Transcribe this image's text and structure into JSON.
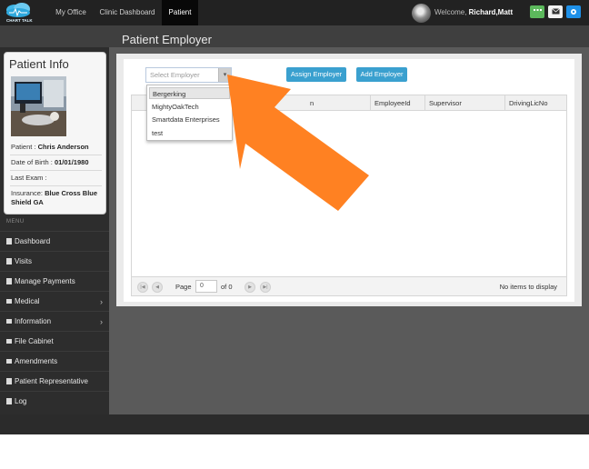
{
  "app": {
    "logo_text": "CHART TALK"
  },
  "nav": {
    "items": [
      {
        "label": "My Office"
      },
      {
        "label": "Clinic Dashboard"
      },
      {
        "label": "Patient"
      }
    ],
    "welcome_prefix": "Welcome,",
    "welcome_user": "Richard,Matt",
    "icons": [
      "grid-icon",
      "mail-icon",
      "gear-icon"
    ],
    "button_colors": [
      "#5cb85c",
      "#f2f2f2",
      "#1e90e8"
    ]
  },
  "page": {
    "title": "Patient Employer"
  },
  "patient_info": {
    "title": "Patient Info",
    "patient_label": "Patient :",
    "patient_value": "Chris Anderson",
    "dob_label": "Date of Birth :",
    "dob_value": "01/01/1980",
    "last_exam_label": "Last Exam :",
    "insurance_label": "Insurance:",
    "insurance_value": "Blue Cross Blue Shield GA"
  },
  "sidebar": {
    "menu_label": "MENU",
    "items": [
      {
        "label": "Dashboard",
        "icon": "document-icon"
      },
      {
        "label": "Visits",
        "icon": "document-icon"
      },
      {
        "label": "Manage Payments",
        "icon": "document-icon"
      },
      {
        "label": "Medical",
        "icon": "list-icon",
        "chevron": "›"
      },
      {
        "label": "Information",
        "icon": "list-icon",
        "chevron": "›"
      },
      {
        "label": "File Cabinet",
        "icon": "list-icon"
      },
      {
        "label": "Amendments",
        "icon": "list-icon"
      },
      {
        "label": "Patient Representative",
        "icon": "document-icon"
      },
      {
        "label": "Log",
        "icon": "document-icon"
      }
    ]
  },
  "employer": {
    "select_placeholder": "Select Employer",
    "assign_button": "Assign Employer",
    "add_button": "Add Employer",
    "options": [
      "Bergerking",
      "MightyOakTech",
      "Smartdata Enterprises",
      "test"
    ],
    "columns": [
      "n",
      "EmployeeId",
      "Supervisor",
      "DrivingLicNo"
    ]
  },
  "pager": {
    "page_label": "Page",
    "page_value": "0",
    "of_label": "of 0",
    "status": "No items to display"
  },
  "colors": {
    "accent_button": "#3aa0cf",
    "arrow": "#ff8122",
    "nav_bg": "#222222"
  }
}
